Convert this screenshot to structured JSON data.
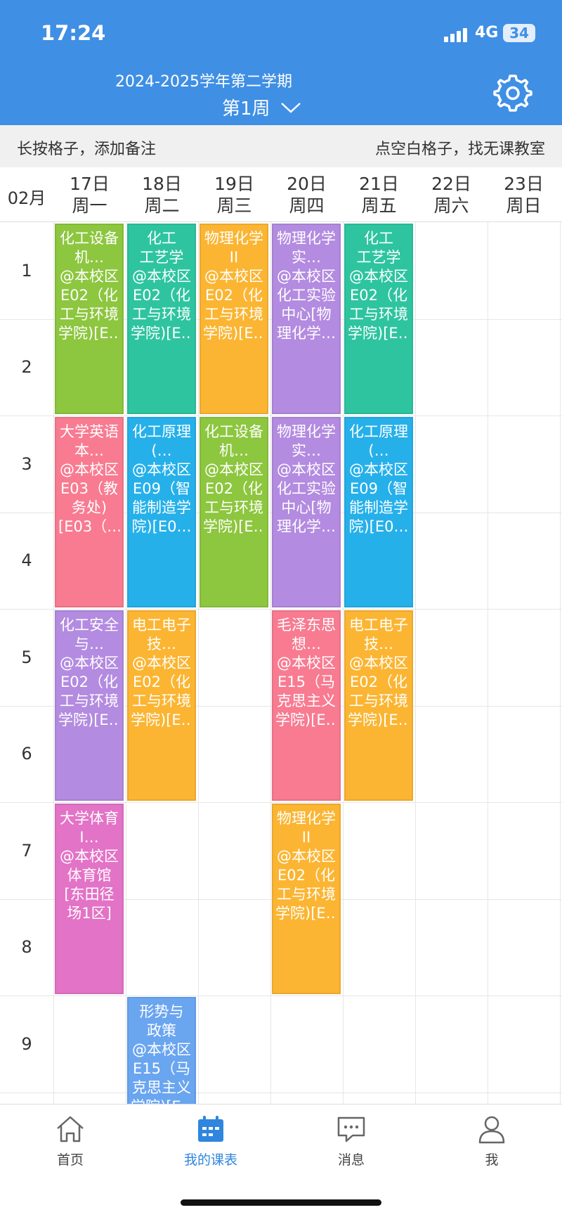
{
  "status": {
    "time": "17:24",
    "network": "4G",
    "battery": "34"
  },
  "header": {
    "term": "2024-2025学年第二学期",
    "week": "第1周"
  },
  "hints": {
    "left": "长按格子，添加备注",
    "right": "点空白格子，找无课教室"
  },
  "month": "02月",
  "days": [
    {
      "date": "17日",
      "weekday": "周一"
    },
    {
      "date": "18日",
      "weekday": "周二"
    },
    {
      "date": "19日",
      "weekday": "周三"
    },
    {
      "date": "20日",
      "weekday": "周四"
    },
    {
      "date": "21日",
      "weekday": "周五"
    },
    {
      "date": "22日",
      "weekday": "周六"
    },
    {
      "date": "23日",
      "weekday": "周日"
    }
  ],
  "periods": [
    "1",
    "2",
    "3",
    "4",
    "5",
    "6",
    "7",
    "8",
    "9"
  ],
  "courses": [
    {
      "day": 0,
      "start": 1,
      "span": 2,
      "color": "#8dc63f",
      "lines": [
        "化工设备",
        "机…",
        "@本校区",
        "E02（化",
        "工与环境",
        "学院)[E…"
      ]
    },
    {
      "day": 1,
      "start": 1,
      "span": 2,
      "color": "#2ec4a0",
      "lines": [
        "化工",
        "工艺学",
        "@本校区",
        "E02（化",
        "工与环境",
        "学院)[E…"
      ]
    },
    {
      "day": 2,
      "start": 1,
      "span": 2,
      "color": "#fbb532",
      "lines": [
        "物理化学",
        "II",
        "@本校区",
        "E02（化",
        "工与环境",
        "学院)[E…"
      ]
    },
    {
      "day": 3,
      "start": 1,
      "span": 2,
      "color": "#b38be0",
      "lines": [
        "物理化学",
        "实…",
        "@本校区",
        "化工实验",
        "中心[物",
        "理化学…"
      ]
    },
    {
      "day": 4,
      "start": 1,
      "span": 2,
      "color": "#2ec4a0",
      "lines": [
        "化工",
        "工艺学",
        "@本校区",
        "E02（化",
        "工与环境",
        "学院)[E…"
      ]
    },
    {
      "day": 0,
      "start": 3,
      "span": 2,
      "color": "#f87b91",
      "lines": [
        "大学英语",
        "本…",
        "@本校区",
        "E03（教",
        "务处)",
        "[E03（…"
      ]
    },
    {
      "day": 1,
      "start": 3,
      "span": 2,
      "color": "#26b0ea",
      "lines": [
        "化工原理",
        "(…",
        "@本校区",
        "E09（智",
        "能制造学",
        "院)[E0…"
      ]
    },
    {
      "day": 2,
      "start": 3,
      "span": 2,
      "color": "#8dc63f",
      "lines": [
        "化工设备",
        "机…",
        "@本校区",
        "E02（化",
        "工与环境",
        "学院)[E…"
      ]
    },
    {
      "day": 3,
      "start": 3,
      "span": 2,
      "color": "#b38be0",
      "lines": [
        "物理化学",
        "实…",
        "@本校区",
        "化工实验",
        "中心[物",
        "理化学…"
      ]
    },
    {
      "day": 4,
      "start": 3,
      "span": 2,
      "color": "#26b0ea",
      "lines": [
        "化工原理",
        "(…",
        "@本校区",
        "E09（智",
        "能制造学",
        "院)[E0…"
      ]
    },
    {
      "day": 0,
      "start": 5,
      "span": 2,
      "color": "#b38be0",
      "lines": [
        "化工安全",
        "与…",
        "@本校区",
        "E02（化",
        "工与环境",
        "学院)[E…"
      ]
    },
    {
      "day": 1,
      "start": 5,
      "span": 2,
      "color": "#fbb532",
      "lines": [
        "电工电子",
        "技…",
        "@本校区",
        "E02（化",
        "工与环境",
        "学院)[E…"
      ]
    },
    {
      "day": 3,
      "start": 5,
      "span": 2,
      "color": "#f87b91",
      "lines": [
        "毛泽东思",
        "想…",
        "@本校区",
        "E15（马",
        "克思主义",
        "学院)[E…"
      ]
    },
    {
      "day": 4,
      "start": 5,
      "span": 2,
      "color": "#fbb532",
      "lines": [
        "电工电子",
        "技…",
        "@本校区",
        "E02（化",
        "工与环境",
        "学院)[E…"
      ]
    },
    {
      "day": 0,
      "start": 7,
      "span": 2,
      "color": "#e373c6",
      "lines": [
        "大学体育",
        "I…",
        "@本校区",
        "体育馆",
        "[东田径",
        "场1区]"
      ]
    },
    {
      "day": 3,
      "start": 7,
      "span": 2,
      "color": "#fbb532",
      "lines": [
        "物理化学",
        "II",
        "@本校区",
        "E02（化",
        "工与环境",
        "学院)[E…"
      ]
    },
    {
      "day": 1,
      "start": 9,
      "span": 2,
      "color": "#6aa5f0",
      "lines": [
        "形势与",
        "政策",
        "@本校区",
        "E15（马",
        "克思主义",
        "学院)[E…"
      ]
    }
  ],
  "tabs": [
    {
      "label": "首页",
      "icon": "home-icon",
      "active": false
    },
    {
      "label": "我的课表",
      "icon": "calendar-icon",
      "active": true
    },
    {
      "label": "消息",
      "icon": "message-icon",
      "active": false
    },
    {
      "label": "我",
      "icon": "user-icon",
      "active": false
    }
  ],
  "colors": {
    "primary": "#3f8fe4",
    "active_tab": "#2e86de"
  }
}
